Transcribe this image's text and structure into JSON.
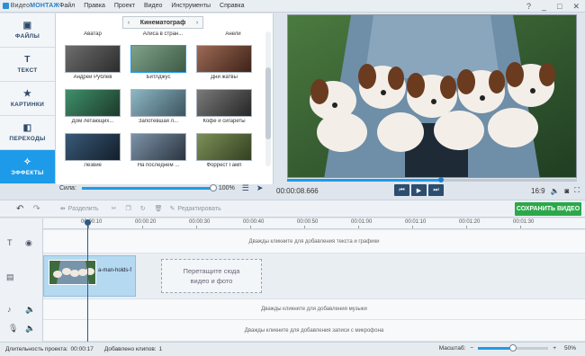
{
  "app": {
    "logo_prefix": "Видео",
    "logo_suffix": "МОНТАЖ",
    "menu": [
      "Файл",
      "Правка",
      "Проект",
      "Видео",
      "Инструменты",
      "Справка"
    ],
    "window_controls": [
      "?",
      "_",
      "□",
      "✕"
    ]
  },
  "sidebar": {
    "tabs": [
      {
        "label": "ФАЙЛЫ",
        "icon": "image-icon"
      },
      {
        "label": "ТЕКСТ",
        "icon": "text-icon"
      },
      {
        "label": "КАРТИНКИ",
        "icon": "star-icon"
      },
      {
        "label": "ПЕРЕХОДЫ",
        "icon": "transitions-icon"
      },
      {
        "label": "ЭФФЕКТЫ",
        "icon": "magic-wand-icon"
      }
    ],
    "active_index": 4
  },
  "gallery": {
    "category": "Кинематограф",
    "top_labels": [
      "Аватар",
      "Алиса в стран...",
      "Анели"
    ],
    "items": [
      {
        "caption": "Андрей Рублев",
        "color_a": "#6d6d6d",
        "color_b": "#2c2c2c"
      },
      {
        "caption": "Битлджус",
        "color_a": "#7fa28a",
        "color_b": "#3e5a45"
      },
      {
        "caption": "Дни жатвы",
        "color_a": "#9c6a55",
        "color_b": "#3e2218"
      },
      {
        "caption": "Дом летающих...",
        "color_a": "#3f8f6a",
        "color_b": "#1d3a2a"
      },
      {
        "caption": "Запотевшая л...",
        "color_a": "#8fb7c4",
        "color_b": "#3b5560"
      },
      {
        "caption": "Кофе и сигареты",
        "color_a": "#7a7a7a",
        "color_b": "#262626"
      },
      {
        "caption": "Лезвие",
        "color_a": "#3a5a78",
        "color_b": "#121e2a"
      },
      {
        "caption": "На последнем ...",
        "color_a": "#7d93a8",
        "color_b": "#2a3440"
      },
      {
        "caption": "Форрест Гамп",
        "color_a": "#7d8f58",
        "color_b": "#324020"
      }
    ],
    "selected_index": 1,
    "strength_label": "Сила:",
    "strength_value": "100%",
    "strength": 1.0
  },
  "preview": {
    "time": "00:00:08.666",
    "progress": 0.53,
    "aspect": "16:9",
    "controls": [
      "⏮",
      "▶",
      "⏭"
    ]
  },
  "toolbar": {
    "split": "Разделить",
    "edit": "Редактировать",
    "save": "СОХРАНИТЬ ВИДЕО"
  },
  "ruler": {
    "labels": [
      "00:00:10",
      "00:00:20",
      "00:00:30",
      "00:00:40",
      "00:00:50",
      "00:01:00",
      "00:01:10",
      "00:01:20",
      "00:01:30"
    ]
  },
  "timeline": {
    "text_hint": "Дважды кликните для добавления текста и графики",
    "clip_name": "a-man-holds-f",
    "drop_line1": "Перетащите сюда",
    "drop_line2": "видео и фото",
    "music_hint": "Дважды кликните для добавления музыки",
    "mic_hint": "Дважды кликните для добавления записи с микрофона"
  },
  "status": {
    "duration_label": "Длительность проекта:",
    "duration_value": "00:00:17",
    "clips_label": "Добавлено клипов:",
    "clips_value": "1",
    "scale_label": "Масштаб:",
    "scale_value": "50%",
    "scale": 0.5
  }
}
